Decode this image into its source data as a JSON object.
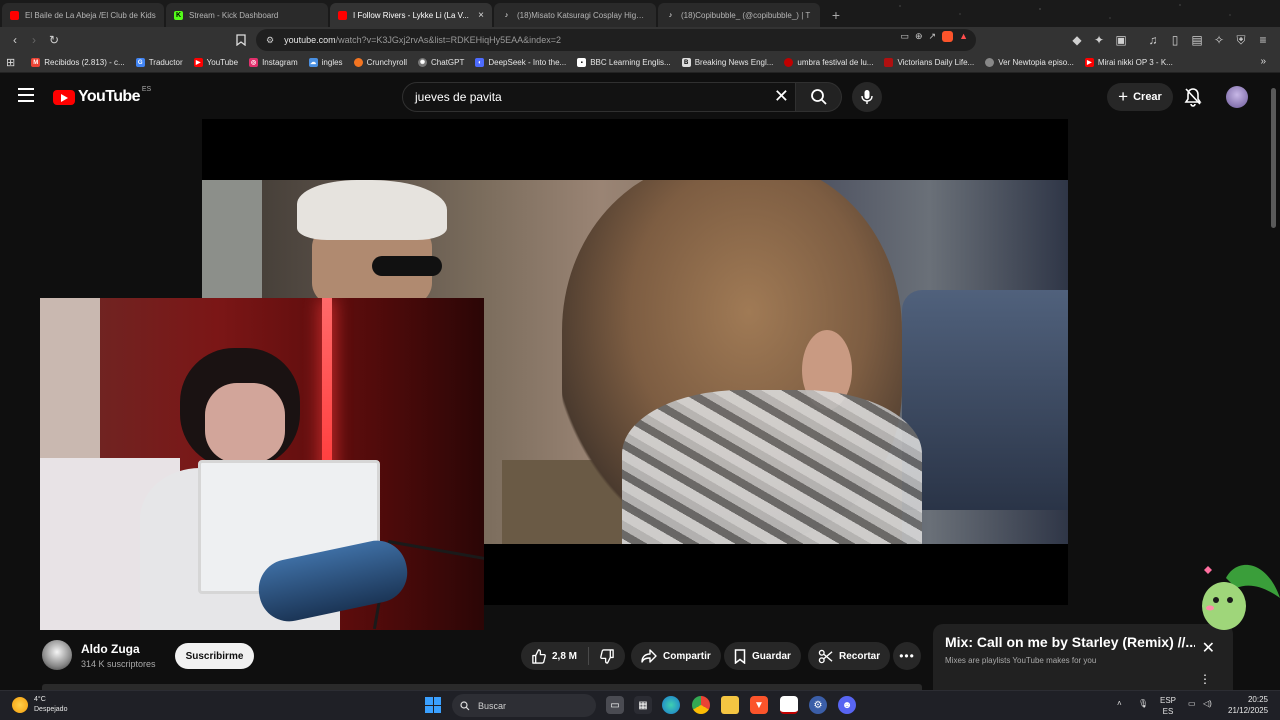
{
  "tabs": [
    {
      "label": "El Baile de La Abeja /El Club de Kids",
      "favicon": "youtube-icon",
      "color": "#ff0000"
    },
    {
      "label": "Stream - Kick Dashboard",
      "favicon": "kick-icon",
      "color": "#53fc18"
    },
    {
      "label": "I Follow Rivers - Lykke Li (La V...",
      "favicon": "youtube-icon",
      "color": "#ff0000",
      "active": true
    },
    {
      "label": "(18)Misato Katsuragi Cosplay Highlig",
      "favicon": "tiktok-icon",
      "color": "#ffffff"
    },
    {
      "label": "(18)Copibubble_ (@copibubble_) | T",
      "favicon": "tiktok-icon",
      "color": "#ffffff"
    }
  ],
  "browser": {
    "url_main": "youtube.com",
    "url_rest": "/watch?v=K3JGxj2rvAs&list=RDKEHiqHy5EAA&index=2"
  },
  "bookmarks": [
    {
      "label": "Recibidos (2.813) - c...",
      "icon": "gmail-icon",
      "color": "#ea4335"
    },
    {
      "label": "Traductor",
      "icon": "translate-icon",
      "color": "#4285f4"
    },
    {
      "label": "YouTube",
      "icon": "youtube-icon",
      "color": "#ff0000"
    },
    {
      "label": "Instagram",
      "icon": "instagram-icon",
      "color": "#e1306c"
    },
    {
      "label": "ingles",
      "icon": "cloud-icon",
      "color": "#4a90e2"
    },
    {
      "label": "Crunchyroll",
      "icon": "crunchyroll-icon",
      "color": "#f47521"
    },
    {
      "label": "ChatGPT",
      "icon": "chatgpt-icon",
      "color": "#777777"
    },
    {
      "label": "DeepSeek - Into the...",
      "icon": "deepseek-icon",
      "color": "#4d6bfe"
    },
    {
      "label": "BBC Learning Englis...",
      "icon": "bbc-icon",
      "color": "#ffffff"
    },
    {
      "label": "Breaking News Engl...",
      "icon": "bne-icon",
      "color": "#dddddd"
    },
    {
      "label": "umbra festival de lu...",
      "icon": "umbra-icon",
      "color": "#c00000"
    },
    {
      "label": "Victorians Daily Life...",
      "icon": "victorians-icon",
      "color": "#b01010"
    },
    {
      "label": "Ver Newtopia episo...",
      "icon": "newtopia-icon",
      "color": "#888888"
    },
    {
      "label": "Mirai nikki OP 3 - K...",
      "icon": "youtube-icon",
      "color": "#ff0000"
    }
  ],
  "youtube": {
    "logo": "YouTube",
    "country": "ES",
    "search_query": "jueves de pavita",
    "create_label": "Crear",
    "channel_name": "Aldo Zuga",
    "subscribers": "314 K suscriptores",
    "subscribe_label": "Suscribirme",
    "likes": "2,8 M",
    "share_label": "Compartir",
    "save_label": "Guardar",
    "clip_label": "Recortar",
    "mix_title": "Mix: Call on me by Starley (Remix) //...",
    "mix_subtitle": "Mixes are playlists YouTube makes for you"
  },
  "taskbar": {
    "temperature": "4°C",
    "weather": "Despejado",
    "search_label": "Buscar",
    "lang": "ESP",
    "lang_sub": "ES",
    "time": "20:25",
    "date": "21/12/2025"
  },
  "colors": {
    "yt_red": "#ff0000",
    "brave_orange": "#fb542b",
    "background": "#0f0f0f"
  }
}
